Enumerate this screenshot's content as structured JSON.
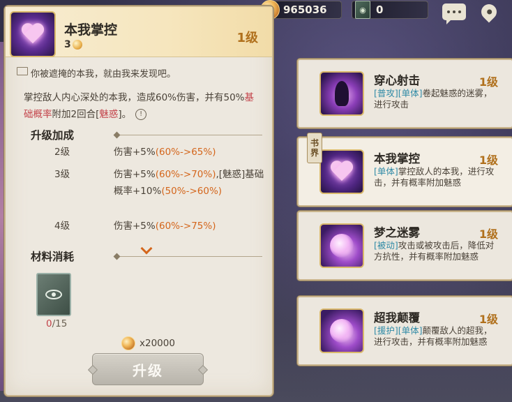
{
  "currency": {
    "gold": "965036",
    "books": "0"
  },
  "detail": {
    "title": "本我掌控",
    "stack": "3",
    "level": "1级",
    "flavor": "你被遮掩的本我，就由我来发现吧。",
    "desc_parts": {
      "p1": "掌控敌人内心深处的本我，造成60%伤害，并有50%",
      "p2": "基础概率",
      "p3": "附加2回合[",
      "p4": "魅惑",
      "p5": "]。"
    },
    "info_icon": "!",
    "upgrade_section": "升级加成",
    "upgrades": [
      {
        "level": "2级",
        "text_a": "伤害+5%",
        "text_b": "(60%->65%)",
        "text_c": "",
        "text_d": ""
      },
      {
        "level": "3级",
        "text_a": "伤害+5%",
        "text_b": "(60%->70%)",
        "text_c": ",[魅惑]基础概率+10%",
        "text_d": "(50%->60%)"
      },
      {
        "level": "4级",
        "text_a": "伤害+5%",
        "text_b": "(60%->75%)",
        "text_c": "",
        "text_d": ""
      }
    ],
    "material_section": "材料消耗",
    "material_have": "0",
    "material_need": "/15",
    "cost": "x20000",
    "upgrade_button": "升级"
  },
  "tab_label": {
    "line1": "书",
    "line2": "界"
  },
  "skills": [
    {
      "title": "穿心射击",
      "level": "1级",
      "tag1": "[普攻]",
      "tag2": "[单体]",
      "desc": "卷起魅惑的迷雾，进行攻击"
    },
    {
      "title": "本我掌控",
      "level": "1级",
      "tag1": "[单体]",
      "tag2": "",
      "desc": "掌控敌人的本我，进行攻击，并有概率附加魅惑"
    },
    {
      "title": "梦之迷雾",
      "level": "1级",
      "tag1": "[被动]",
      "tag2": "",
      "desc": "攻击或被攻击后，降低对方抗性，并有概率附加魅惑"
    },
    {
      "title": "超我颠覆",
      "level": "1级",
      "tag1": "[援护]",
      "tag2": "[单体]",
      "desc": "颠覆敌人的超我，进行攻击，并有概率附加魅惑"
    }
  ],
  "colors": {
    "level_gold": "#b0701c",
    "orange_value": "#d4661c",
    "red_highlight": "#c3434a",
    "tag_blue": "#2f8aa6",
    "panel_bg": "#ede8df"
  },
  "icons": [
    "coin-icon",
    "book-icon",
    "chat-icon",
    "location-pin-icon",
    "heart-icon",
    "info-icon",
    "chevron-down-icon",
    "eye-card-icon",
    "demon-icon",
    "comet-icon"
  ]
}
